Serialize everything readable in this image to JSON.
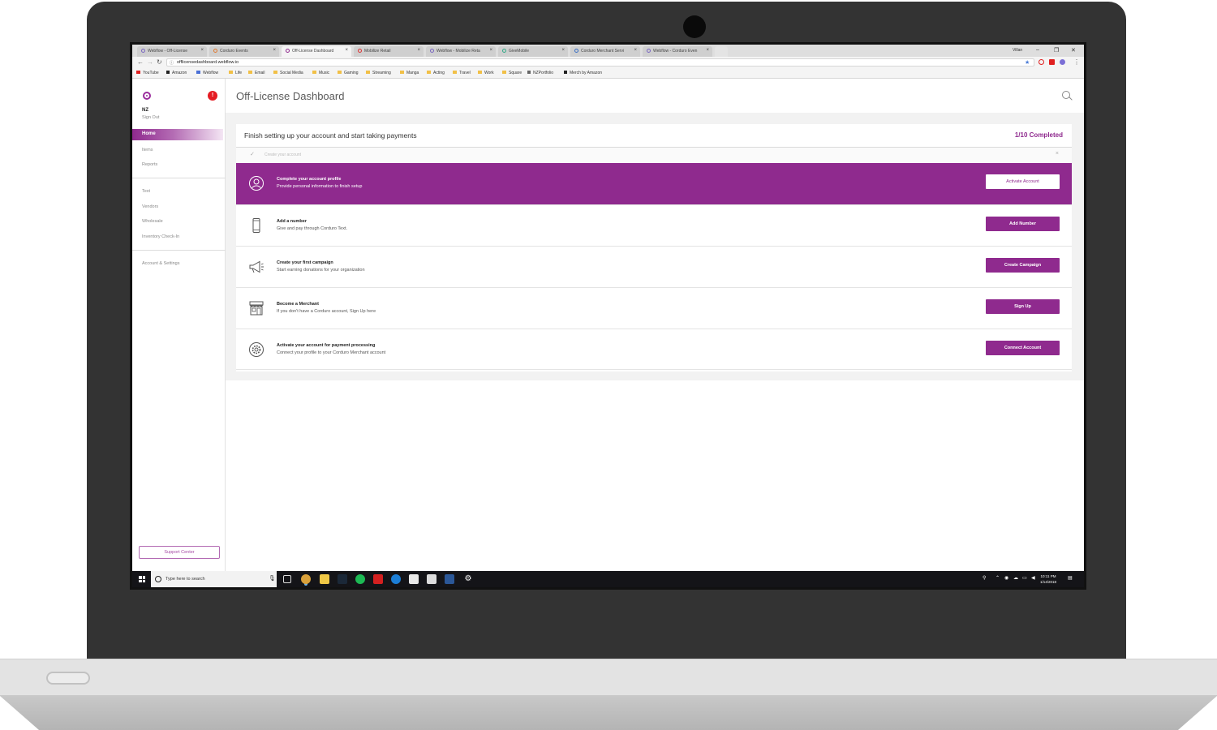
{
  "browser": {
    "tabs": [
      {
        "label": "Webflow - Off-License"
      },
      {
        "label": "Corduro Events"
      },
      {
        "label": "Off-License Dashboard"
      },
      {
        "label": "Mobilize Retail"
      },
      {
        "label": "Webflow - Mobilize Reta"
      },
      {
        "label": "GiveMobile"
      },
      {
        "label": "Corduro Merchant Servi"
      },
      {
        "label": "Webflow - Corduro Even"
      }
    ],
    "user": "Villan",
    "url": "offlicensedashboard.webflow.io",
    "bookmarks": [
      "YouTube",
      "Amazon",
      "Webflow",
      "Life",
      "Email",
      "Social Media",
      "Music",
      "Gaming",
      "Streaming",
      "Manga",
      "Acting",
      "Travel",
      "Work",
      "Square",
      "NZPortfolio",
      "Merch by Amazon"
    ]
  },
  "sidebar": {
    "notification_count": "!",
    "user_name": "NZ",
    "sign_out": "Sign Out",
    "nav_primary": [
      "Home",
      "Items",
      "Reports"
    ],
    "nav_secondary": [
      "Text",
      "Vendors",
      "Wholesale",
      "Inventory Check-In"
    ],
    "nav_tertiary": [
      "Account & Settings"
    ],
    "support": "Support Center"
  },
  "header": {
    "title": "Off-License Dashboard"
  },
  "setup": {
    "heading": "Finish setting up your account and start taking payments",
    "progress": "1/10 Completed",
    "completed_step": "Create your account",
    "tasks": [
      {
        "title": "Complete your account profile",
        "desc": "Provide personal information to finish setup",
        "button": "Activate Account",
        "icon": "user-icon"
      },
      {
        "title": "Add a number",
        "desc": "Give and pay through Corduro Text.",
        "button": "Add Number",
        "icon": "phone-icon"
      },
      {
        "title": "Create your first campaign",
        "desc": "Start earning donations for your organization",
        "button": "Create Campaign",
        "icon": "megaphone-icon"
      },
      {
        "title": "Become a Merchant",
        "desc": "If you don't have a Corduro account, Sign Up here",
        "button": "Sign Up",
        "icon": "storefront-icon"
      },
      {
        "title": "Activate your account for payment processing",
        "desc": "Connect your profile to your Corduro Merchant account",
        "button": "Connect Account",
        "icon": "gear-icon"
      }
    ]
  },
  "taskbar": {
    "search_placeholder": "Type here to search",
    "time": "10:11 PM",
    "date": "1/14/2018"
  },
  "colors": {
    "accent": "#8f2a8e",
    "badge": "#e51c23"
  }
}
